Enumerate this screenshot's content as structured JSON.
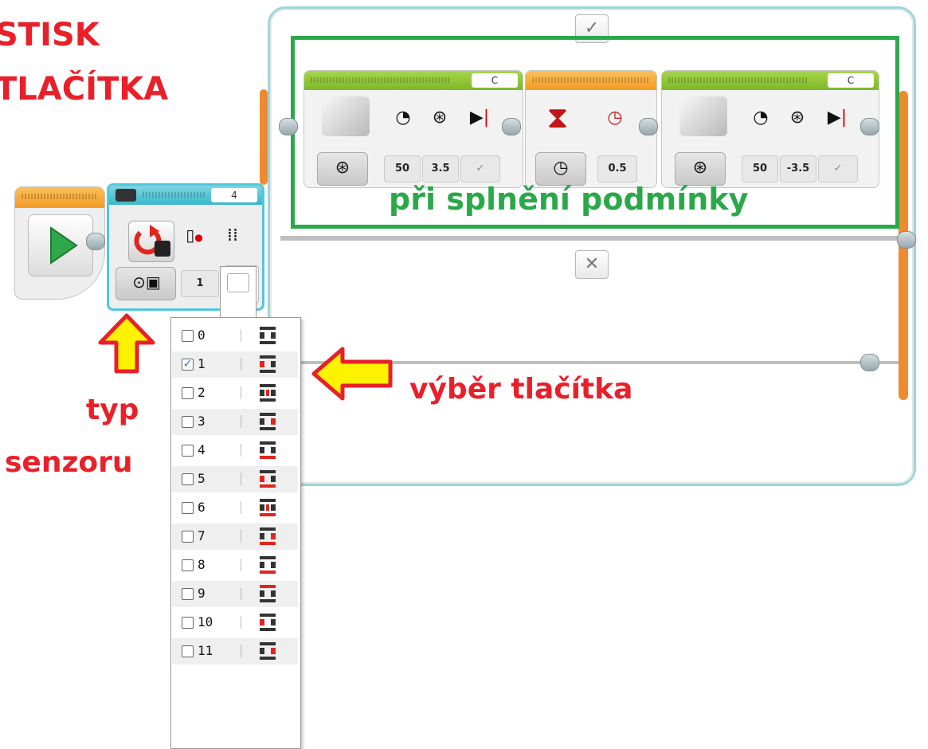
{
  "annotations": {
    "title_line1": "STISK",
    "title_line2": "TLAČÍTKA",
    "true_case_label": "při splnění podmínky",
    "button_select_label": "výběr tlačítka",
    "sensor_type_line1": "typ",
    "sensor_type_line2": "senzoru"
  },
  "colors": {
    "annotation_red": "#e8202a",
    "annotation_green": "#2aa84a",
    "switch_frame": "#9ad6dc",
    "case_rail": "#f08a2e"
  },
  "start_block": {
    "icon": "play-triangle-icon"
  },
  "switch_block": {
    "header_value": "4",
    "mode_icon": "brick-buttons-icon",
    "compare_value": "1",
    "input_icons": [
      "compare-type-icon",
      "button-id-icon"
    ]
  },
  "cases": {
    "true_case_icon": "checkmark-icon",
    "true_case_symbol": "✓",
    "false_case_icon": "cross-icon",
    "false_case_symbol": "✕"
  },
  "motor_block_1": {
    "port": "C",
    "power": "50",
    "rotations": "3.5",
    "brake_icon": "checkmark-icon"
  },
  "wait_block": {
    "time": "0.5"
  },
  "motor_block_2": {
    "port": "C",
    "power": "50",
    "rotations": "-3.5",
    "brake_icon": "checkmark-icon"
  },
  "dropdown": {
    "items": [
      {
        "value": "0",
        "checked": false
      },
      {
        "value": "1",
        "checked": true
      },
      {
        "value": "2",
        "checked": false
      },
      {
        "value": "3",
        "checked": false
      },
      {
        "value": "4",
        "checked": false
      },
      {
        "value": "5",
        "checked": false
      },
      {
        "value": "6",
        "checked": false
      },
      {
        "value": "7",
        "checked": false
      },
      {
        "value": "8",
        "checked": false
      },
      {
        "value": "9",
        "checked": false
      },
      {
        "value": "10",
        "checked": false
      },
      {
        "value": "11",
        "checked": false
      }
    ]
  }
}
